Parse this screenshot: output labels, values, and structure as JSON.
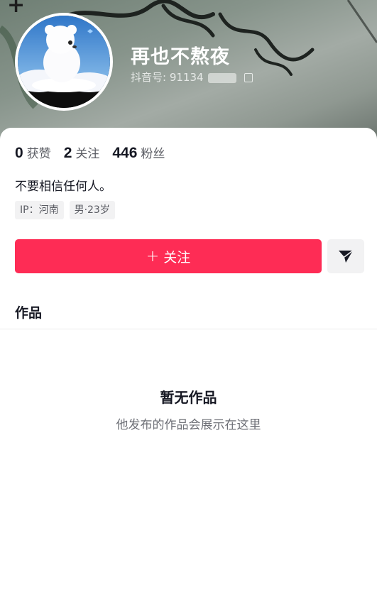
{
  "profile": {
    "username": "再也不熬夜",
    "douyin_id_label": "抖音号:",
    "douyin_id_visible": "91134"
  },
  "stats": [
    {
      "value": "0",
      "label": "获赞"
    },
    {
      "value": "2",
      "label": "关注"
    },
    {
      "value": "446",
      "label": "粉丝"
    }
  ],
  "bio": "不要相信任何人。",
  "tags": [
    "IP：河南",
    "男·23岁"
  ],
  "actions": {
    "follow_plus": "+",
    "follow_label": "关注"
  },
  "tabs": {
    "works": "作品"
  },
  "empty_state": {
    "title": "暂无作品",
    "subtitle": "他发布的作品会展示在这里"
  },
  "colors": {
    "accent": "#fe2c55",
    "chip_bg": "#f2f2f3",
    "text_primary": "#161823",
    "text_secondary": "#5a5c63"
  },
  "icons": [
    "plus-icon",
    "copy-icon",
    "share-icon"
  ]
}
